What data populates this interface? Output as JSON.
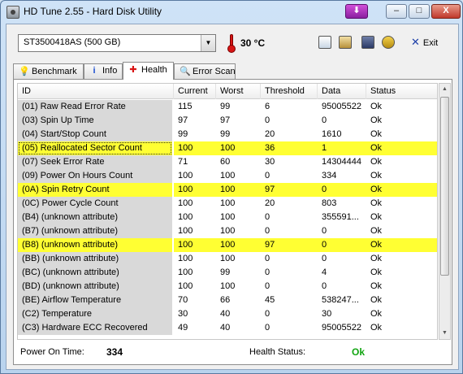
{
  "window": {
    "title": "HD Tune 2.55 - Hard Disk Utility",
    "close_glyph": "X",
    "down_glyph": "⬇",
    "min_glyph": "–",
    "max_glyph": "□"
  },
  "toolbar": {
    "drive": "ST3500418AS (500 GB)",
    "temperature": "30 °C",
    "exit_label": "Exit"
  },
  "tabs": [
    {
      "label": "Benchmark",
      "icon": "lightbulb-icon"
    },
    {
      "label": "Info",
      "icon": "info-icon"
    },
    {
      "label": "Health",
      "icon": "health-cross-icon",
      "active": true
    },
    {
      "label": "Error Scan",
      "icon": "magnifier-icon"
    }
  ],
  "table": {
    "headers": [
      "ID",
      "Current",
      "Worst",
      "Threshold",
      "Data",
      "Status"
    ],
    "rows": [
      {
        "id": "(01) Raw Read Error Rate",
        "current": "115",
        "worst": "99",
        "threshold": "6",
        "data": "95005522",
        "status": "Ok",
        "highlight": false
      },
      {
        "id": "(03) Spin Up Time",
        "current": "97",
        "worst": "97",
        "threshold": "0",
        "data": "0",
        "status": "Ok",
        "highlight": false
      },
      {
        "id": "(04) Start/Stop Count",
        "current": "99",
        "worst": "99",
        "threshold": "20",
        "data": "1610",
        "status": "Ok",
        "highlight": false
      },
      {
        "id": "(05) Reallocated Sector Count",
        "current": "100",
        "worst": "100",
        "threshold": "36",
        "data": "1",
        "status": "Ok",
        "highlight": true
      },
      {
        "id": "(07) Seek Error Rate",
        "current": "71",
        "worst": "60",
        "threshold": "30",
        "data": "14304444",
        "status": "Ok",
        "highlight": false
      },
      {
        "id": "(09) Power On Hours Count",
        "current": "100",
        "worst": "100",
        "threshold": "0",
        "data": "334",
        "status": "Ok",
        "highlight": false
      },
      {
        "id": "(0A) Spin Retry Count",
        "current": "100",
        "worst": "100",
        "threshold": "97",
        "data": "0",
        "status": "Ok",
        "highlight": true
      },
      {
        "id": "(0C) Power Cycle Count",
        "current": "100",
        "worst": "100",
        "threshold": "20",
        "data": "803",
        "status": "Ok",
        "highlight": false
      },
      {
        "id": "(B4) (unknown attribute)",
        "current": "100",
        "worst": "100",
        "threshold": "0",
        "data": "355591...",
        "status": "Ok",
        "highlight": false
      },
      {
        "id": "(B7) (unknown attribute)",
        "current": "100",
        "worst": "100",
        "threshold": "0",
        "data": "0",
        "status": "Ok",
        "highlight": false
      },
      {
        "id": "(B8) (unknown attribute)",
        "current": "100",
        "worst": "100",
        "threshold": "97",
        "data": "0",
        "status": "Ok",
        "highlight": true
      },
      {
        "id": "(BB) (unknown attribute)",
        "current": "100",
        "worst": "100",
        "threshold": "0",
        "data": "0",
        "status": "Ok",
        "highlight": false
      },
      {
        "id": "(BC) (unknown attribute)",
        "current": "100",
        "worst": "99",
        "threshold": "0",
        "data": "4",
        "status": "Ok",
        "highlight": false
      },
      {
        "id": "(BD) (unknown attribute)",
        "current": "100",
        "worst": "100",
        "threshold": "0",
        "data": "0",
        "status": "Ok",
        "highlight": false
      },
      {
        "id": "(BE) Airflow Temperature",
        "current": "70",
        "worst": "66",
        "threshold": "45",
        "data": "538247...",
        "status": "Ok",
        "highlight": false
      },
      {
        "id": "(C2) Temperature",
        "current": "30",
        "worst": "40",
        "threshold": "0",
        "data": "30",
        "status": "Ok",
        "highlight": false
      },
      {
        "id": "(C3) Hardware ECC Recovered",
        "current": "49",
        "worst": "40",
        "threshold": "0",
        "data": "95005522",
        "status": "Ok",
        "highlight": false
      }
    ]
  },
  "status": {
    "power_on_label": "Power On Time:",
    "power_on_value": "334",
    "health_label": "Health Status:",
    "health_value": "Ok"
  },
  "colors": {
    "highlight": "#ffff33",
    "ok_green": "#11a511",
    "id_column_bg": "#d9d9d9"
  }
}
